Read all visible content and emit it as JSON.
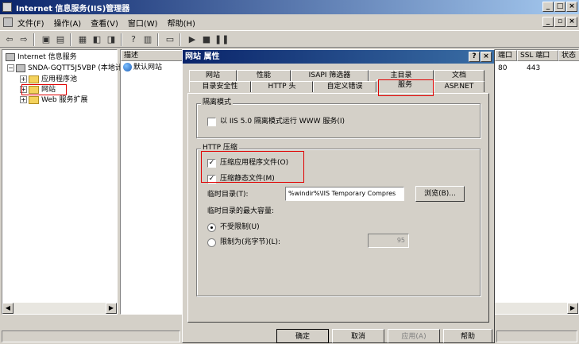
{
  "window": {
    "title": "Internet 信息服务(IIS)管理器"
  },
  "menu": [
    "文件(F)",
    "操作(A)",
    "查看(V)",
    "窗口(W)",
    "帮助(H)"
  ],
  "tree": {
    "root": "Internet 信息服务",
    "server": "SNDA-GQTT5J5VBP (本地计",
    "app_pools": "应用程序池",
    "websites": "网站",
    "web_ext": "Web 服务扩展"
  },
  "mid_list": {
    "header": "描述",
    "item": "默认网站"
  },
  "right_list": {
    "headers": [
      "端口",
      "SSL 端口",
      "状态"
    ],
    "row": {
      "port": "80",
      "ssl_port": "443"
    }
  },
  "dialog": {
    "title": "网站 属性",
    "help_btn": "?",
    "tabs_row1": [
      "网站",
      "性能",
      "ISAPI 筛选器",
      "主目录",
      "文档"
    ],
    "tabs_row2": [
      "目录安全性",
      "HTTP 头",
      "自定义错误",
      "服务",
      "ASP.NET"
    ],
    "isolation": {
      "label": "隔离模式",
      "checkbox": "以 IIS 5.0 隔离模式运行 WWW 服务(I)"
    },
    "compression": {
      "label": "HTTP 压缩",
      "compress_app": "压缩应用程序文件(O)",
      "compress_static": "压缩静态文件(M)",
      "temp_dir_label": "临时目录(T):",
      "temp_dir_value": "%windir%\\IIS Temporary Compres",
      "browse": "浏览(B)...",
      "max_size_label": "临时目录的最大容量:",
      "unlimited": "不受限制(U)",
      "limit": "限制为(兆字节)(L):",
      "limit_value": "95"
    },
    "buttons": {
      "ok": "确定",
      "cancel": "取消",
      "apply": "应用(A)",
      "help": "帮助"
    }
  }
}
